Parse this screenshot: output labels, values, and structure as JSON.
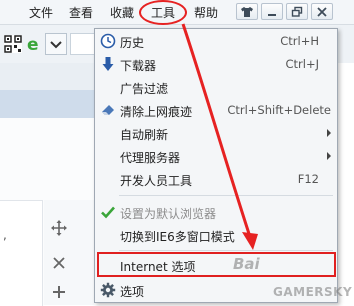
{
  "menubar": {
    "items": [
      "文件",
      "查看",
      "收藏",
      "工具",
      "帮助"
    ],
    "window_buttons": [
      "shirt-icon",
      "minimize-icon",
      "restore-icon",
      "close-icon"
    ]
  },
  "toolbar": {
    "icons": [
      "qr-icon",
      "ie-icon",
      "chevron-down-icon"
    ]
  },
  "menu": {
    "items": [
      {
        "label": "历史",
        "shortcut": "Ctrl+H",
        "icon": "clock-icon"
      },
      {
        "label": "下载器",
        "shortcut": "Ctrl+J",
        "icon": "download-icon"
      },
      {
        "label": "广告过滤",
        "shortcut": "",
        "icon": ""
      },
      {
        "label": "清除上网痕迹",
        "shortcut": "Ctrl+Shift+Delete",
        "icon": "eraser-icon"
      },
      {
        "label": "自动刷新",
        "shortcut": "",
        "icon": "",
        "submenu": true
      },
      {
        "label": "代理服务器",
        "shortcut": "",
        "icon": "",
        "submenu": true
      },
      {
        "label": "开发人员工具",
        "shortcut": "F12",
        "icon": ""
      },
      {
        "label": "设置为默认浏览器",
        "shortcut": "",
        "icon": "checkmark-icon",
        "disabled": true
      },
      {
        "label": "切换到IE6多窗口模式",
        "shortcut": "",
        "icon": ""
      },
      {
        "label": "Internet 选项",
        "shortcut": "",
        "icon": ""
      },
      {
        "label": "选项",
        "shortcut": "",
        "icon": "gear-icon"
      }
    ]
  },
  "sidebar": {
    "icons": [
      "move-icon",
      "close-icon",
      "plus-icon"
    ]
  },
  "watermarks": {
    "site": "GAMERSKY",
    "baidu": "Bai"
  },
  "colors": {
    "annotation_red": "#e62222",
    "menu_bg": "#f4f6f8",
    "checkmark_green": "#3aa53a"
  }
}
